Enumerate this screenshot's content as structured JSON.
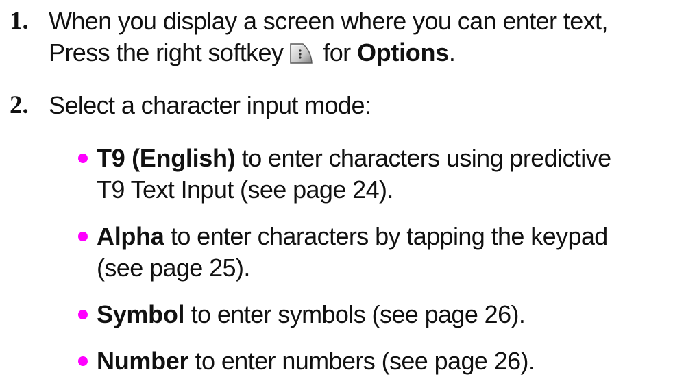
{
  "steps": [
    {
      "number": "1.",
      "line1": "When you display a screen where you can enter text,",
      "line2_pre": "Press the right softkey",
      "line2_mid": "for",
      "line2_bold": "Options",
      "line2_post": "."
    },
    {
      "number": "2.",
      "text": "Select a character input mode:"
    }
  ],
  "softkey_icon": "right-softkey-icon",
  "bullets": [
    {
      "term": "T9 (English)",
      "line1_rest": " to enter characters using predictive",
      "line2": "T9 Text Input (see page 24)."
    },
    {
      "term": "Alpha",
      "line1_rest": " to enter characters by tapping the keypad",
      "line2": "(see page 25)."
    },
    {
      "term": "Symbol",
      "line1_rest": " to enter symbols (see page 26)."
    },
    {
      "term": "Number",
      "line1_rest": " to enter numbers (see page 26)."
    }
  ],
  "colors": {
    "bullet": "#ff00ff",
    "text": "#111111"
  }
}
